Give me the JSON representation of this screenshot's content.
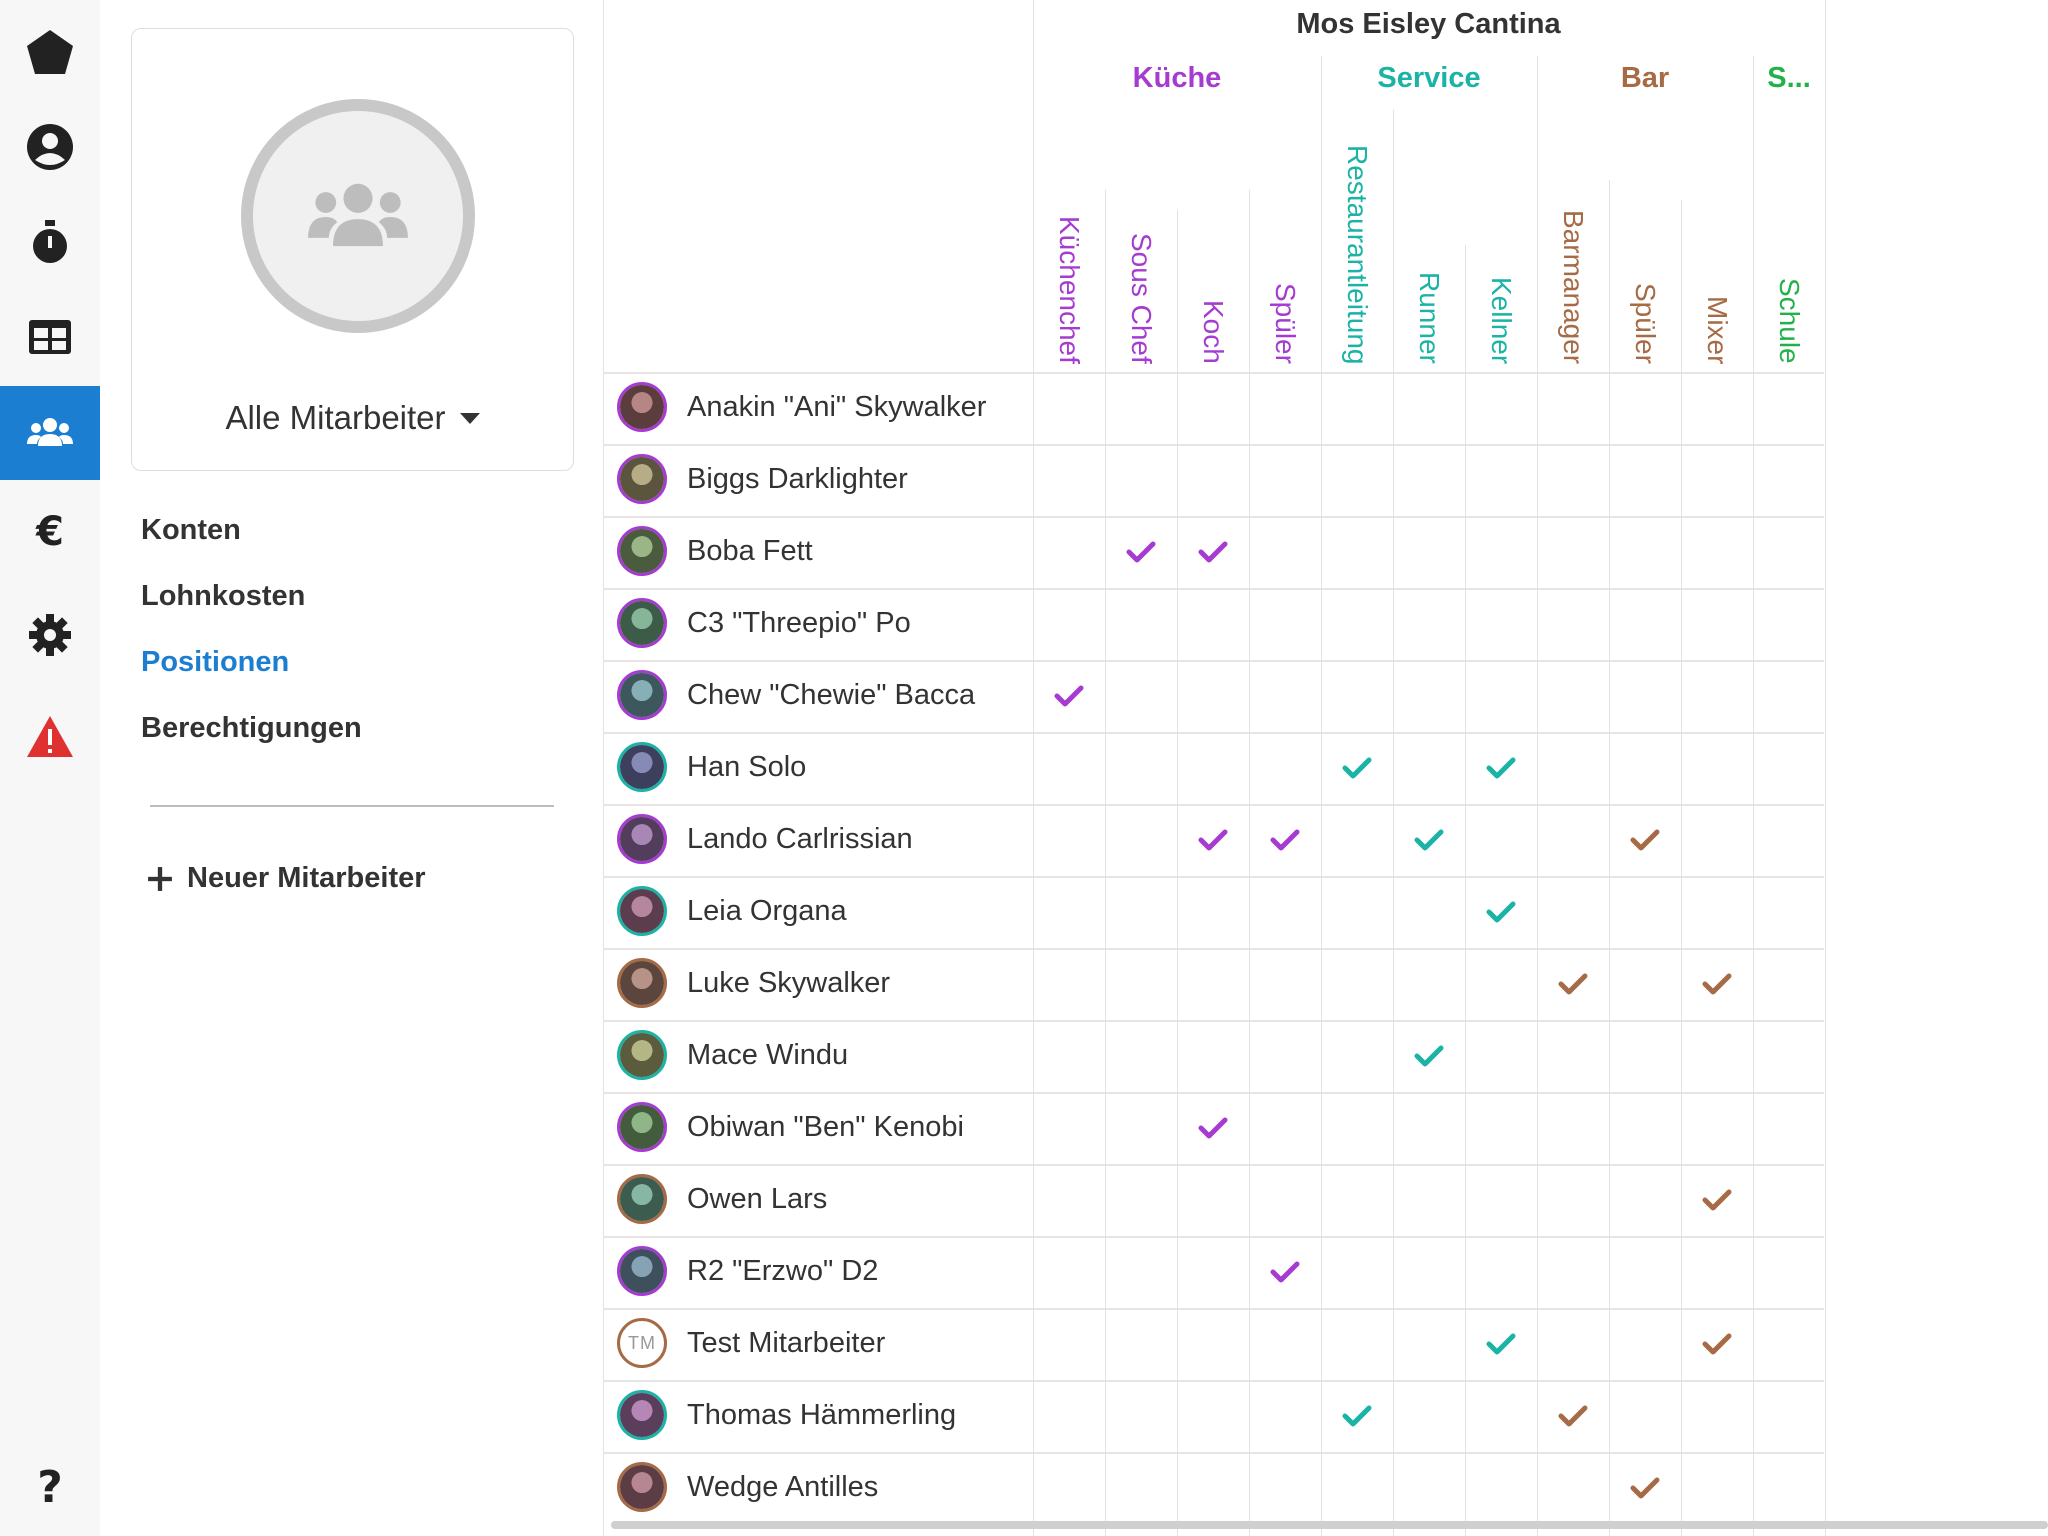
{
  "rail": {
    "items": [
      {
        "icon": "pentagon-logo-icon",
        "active": false
      },
      {
        "icon": "user-circle-icon",
        "active": false
      },
      {
        "icon": "stopwatch-icon",
        "active": false
      },
      {
        "icon": "table-icon",
        "active": false
      },
      {
        "icon": "users-icon",
        "active": true
      },
      {
        "icon": "euro-icon",
        "active": false
      },
      {
        "icon": "gear-icon",
        "active": false
      },
      {
        "icon": "warning-icon",
        "active": false
      },
      {
        "icon": "question-icon",
        "active": false
      }
    ],
    "colors": {
      "active_bg": "#1c7ed0",
      "warning": "#e03131"
    }
  },
  "panel": {
    "group_select_label": "Alle Mitarbeiter",
    "nav": [
      {
        "label": "Konten",
        "active": false
      },
      {
        "label": "Lohnkosten",
        "active": false
      },
      {
        "label": "Positionen",
        "active": true
      },
      {
        "label": "Berechtigungen",
        "active": false
      }
    ],
    "new_employee_label": "Neuer Mitarbeiter"
  },
  "grid": {
    "location_title": "Mos Eisley Cantina",
    "groups": [
      {
        "label": "Küche",
        "color": "#a53bd1"
      },
      {
        "label": "Service",
        "color": "#1ab3a6"
      },
      {
        "label": "Bar",
        "color": "#a66a45"
      },
      {
        "label": "S...",
        "color": "#21b14b"
      }
    ],
    "columns": [
      {
        "label": "Küchenchef",
        "group": 0
      },
      {
        "label": "Sous Chef",
        "group": 0
      },
      {
        "label": "Koch",
        "group": 0
      },
      {
        "label": "Spüler",
        "group": 0
      },
      {
        "label": "Restaurantleitung",
        "group": 1
      },
      {
        "label": "Runner",
        "group": 1
      },
      {
        "label": "Kellner",
        "group": 1
      },
      {
        "label": "Barmanager",
        "group": 2
      },
      {
        "label": "Spüler",
        "group": 2
      },
      {
        "label": "Mixer",
        "group": 2
      },
      {
        "label": "Schule",
        "group": 3
      }
    ],
    "employees": [
      {
        "name": "Anakin \"Ani\" Skywalker",
        "ring": "#a53bd1",
        "initials": "",
        "checks": []
      },
      {
        "name": "Biggs Darklighter",
        "ring": "#a53bd1",
        "initials": "",
        "checks": []
      },
      {
        "name": "Boba Fett",
        "ring": "#a53bd1",
        "initials": "",
        "checks": [
          1,
          2
        ]
      },
      {
        "name": "C3 \"Threepio\" Po",
        "ring": "#a53bd1",
        "initials": "",
        "checks": []
      },
      {
        "name": "Chew \"Chewie\" Bacca",
        "ring": "#a53bd1",
        "initials": "",
        "checks": [
          0
        ]
      },
      {
        "name": "Han Solo",
        "ring": "#1ab3a6",
        "initials": "",
        "checks": [
          4,
          6
        ]
      },
      {
        "name": "Lando Carlrissian",
        "ring": "#a53bd1",
        "initials": "",
        "checks": [
          2,
          3,
          5,
          8
        ]
      },
      {
        "name": "Leia Organa",
        "ring": "#1ab3a6",
        "initials": "",
        "checks": [
          6
        ]
      },
      {
        "name": "Luke Skywalker",
        "ring": "#a66a45",
        "initials": "",
        "checks": [
          7,
          9
        ]
      },
      {
        "name": "Mace Windu",
        "ring": "#1ab3a6",
        "initials": "",
        "checks": [
          5
        ]
      },
      {
        "name": "Obiwan \"Ben\" Kenobi",
        "ring": "#a53bd1",
        "initials": "",
        "checks": [
          2
        ]
      },
      {
        "name": "Owen Lars",
        "ring": "#a66a45",
        "initials": "",
        "checks": [
          9
        ]
      },
      {
        "name": "R2 \"Erzwo\" D2",
        "ring": "#a53bd1",
        "initials": "",
        "checks": [
          3
        ]
      },
      {
        "name": "Test Mitarbeiter",
        "ring": "#a66a45",
        "initials": "TM",
        "checks": [
          6,
          9
        ]
      },
      {
        "name": "Thomas Hämmerling",
        "ring": "#1ab3a6",
        "initials": "",
        "checks": [
          4,
          7
        ]
      },
      {
        "name": "Wedge Antilles",
        "ring": "#a66a45",
        "initials": "",
        "checks": [
          8
        ]
      }
    ]
  }
}
